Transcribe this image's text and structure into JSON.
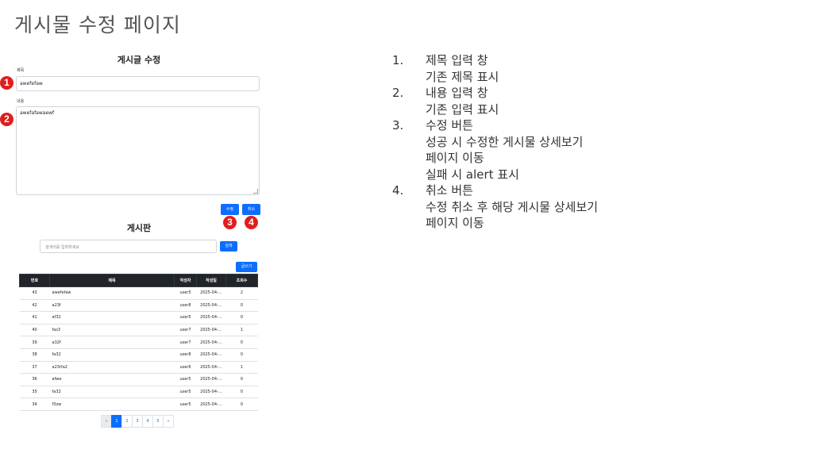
{
  "slide": {
    "title": "게시물 수정 페이지"
  },
  "edit_form": {
    "heading": "게시글 수정",
    "title_label": "제목",
    "title_value": "awefefaw",
    "content_label": "내용",
    "content_value": "awefafawaewf",
    "edit_button": "수정",
    "cancel_button": "취소"
  },
  "markers": [
    "1",
    "2",
    "3",
    "4"
  ],
  "board": {
    "heading": "게시판",
    "search_placeholder": "검색어를 입력하세요",
    "search_button": "검색",
    "write_button": "글쓰기",
    "columns": [
      "번호",
      "제목",
      "작성자",
      "작성일",
      "조회수"
    ],
    "rows": [
      [
        "43",
        "awefefaw",
        "user5",
        "2025-04-…",
        "2"
      ],
      [
        "42",
        "a23f",
        "user8",
        "2025-04-…",
        "0"
      ],
      [
        "41",
        "af32",
        "user5",
        "2025-04-…",
        "0"
      ],
      [
        "40",
        "fas3",
        "user7",
        "2025-04-…",
        "1"
      ],
      [
        "39",
        "a32f",
        "user7",
        "2025-04-…",
        "0"
      ],
      [
        "38",
        "fa32",
        "user8",
        "2025-04-…",
        "0"
      ],
      [
        "37",
        "a23rfa2",
        "user6",
        "2025-04-…",
        "1"
      ],
      [
        "36",
        "afwe",
        "user5",
        "2025-04-…",
        "0"
      ],
      [
        "35",
        "fa32",
        "user5",
        "2025-04-…",
        "0"
      ],
      [
        "34",
        "f3zw",
        "user5",
        "2025-04-…",
        "0"
      ]
    ],
    "pagination": [
      "«",
      "1",
      "2",
      "3",
      "4",
      "5",
      "»"
    ],
    "active_page": "1"
  },
  "notes": [
    {
      "num": "1.",
      "lines": [
        "제목 입력 창",
        "기존 제목 표시"
      ]
    },
    {
      "num": "2.",
      "lines": [
        "내용 입력 창",
        "기존 입력 표시"
      ]
    },
    {
      "num": "3.",
      "lines": [
        "수정 버튼",
        "성공 시 수정한 게시물 상세보기",
        "페이지 이동",
        "실패 시 alert 표시"
      ]
    },
    {
      "num": "4.",
      "lines": [
        "취소 버튼",
        "수정 취소 후 해당 게시물 상세보기",
        "페이지 이동"
      ]
    }
  ],
  "colors": {
    "primary": "#0d6efd",
    "marker": "#e01d1d",
    "table_header": "#212529"
  }
}
